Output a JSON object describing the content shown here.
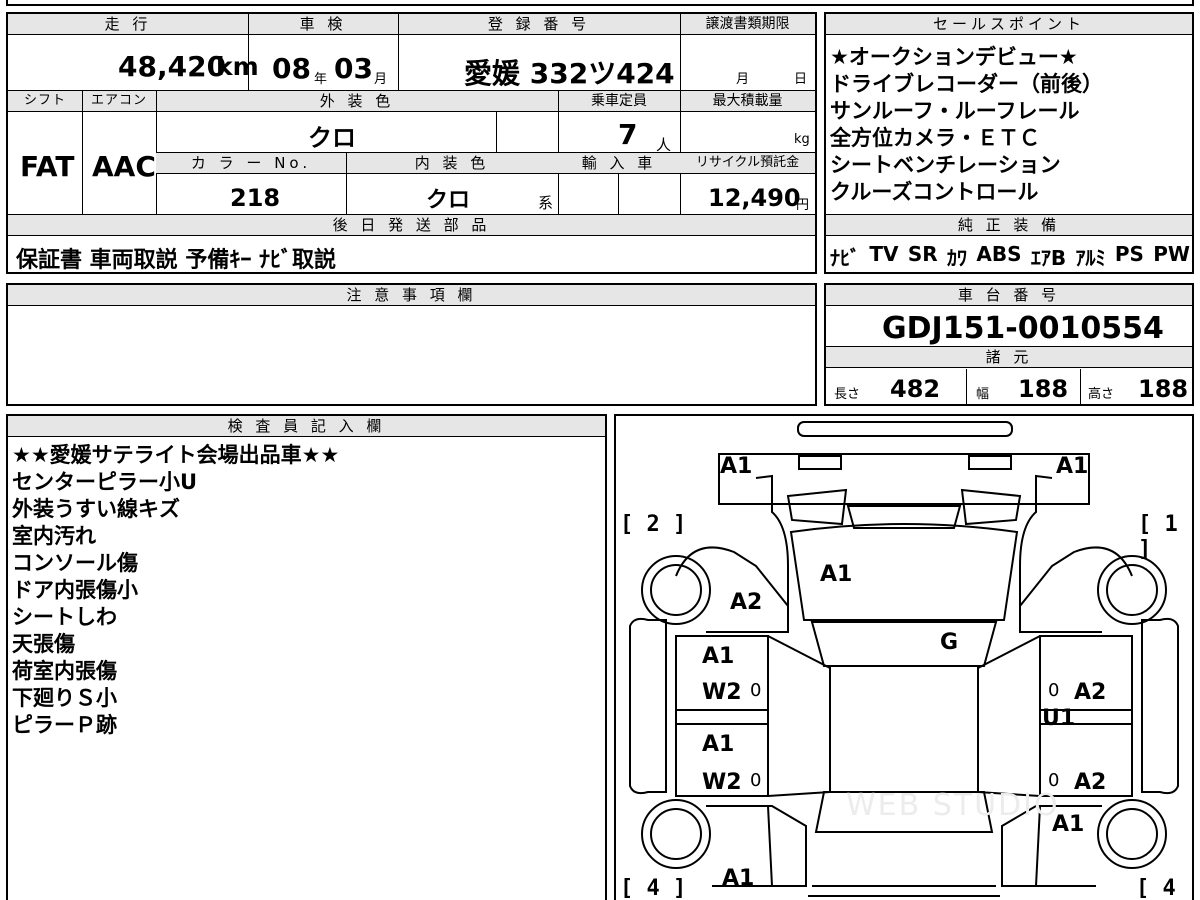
{
  "top": {
    "mileage_label": "走 行",
    "mileage_value": "48,420",
    "mileage_unit": "km",
    "shaken_label": "車 検",
    "shaken_year": "08",
    "shaken_year_unit": "年",
    "shaken_month": "03",
    "shaken_month_unit": "月",
    "reg_label": "登 録 番 号",
    "reg_value": "愛媛 332ツ424",
    "deadline_label": "譲渡書類期限",
    "deadline_month_unit": "月",
    "deadline_day_unit": "日",
    "shift_label": "シフト",
    "shift_value": "FAT",
    "ac_label": "エアコン",
    "ac_value": "AAC",
    "exterior_label": "外 装 色",
    "exterior_value": "クロ",
    "capacity_label": "乗車定員",
    "capacity_value": "7",
    "capacity_unit": "人",
    "maxload_label": "最大積載量",
    "maxload_unit": "kg",
    "colorno_label": "カ ラ ー No.",
    "colorno_value": "218",
    "interior_label": "内 装 色",
    "interior_value": "クロ",
    "interior_suffix": "系",
    "import_label": "輸 入 車",
    "recycle_label": "リサイクル預託金",
    "recycle_value": "12,490",
    "recycle_unit": "円",
    "later_label": "後 日 発 送 部 品",
    "later_value": "保証書 車両取説 予備ｷｰ ﾅﾋﾞ取説"
  },
  "sales": {
    "label": "セールスポイント",
    "items": [
      "★オークションデビュー★",
      "ドライブレコーダー（前後）",
      "サンルーフ・ルーフレール",
      "全方位カメラ・ＥＴＣ",
      "シートベンチレーション",
      "クルーズコントロール"
    ]
  },
  "equip": {
    "label": "純 正 装 備",
    "items": [
      "ﾅﾋﾞ",
      "TV",
      "SR",
      "ｶﾜ",
      "ABS",
      "ｴｱB",
      "ｱﾙﾐ",
      "PS",
      "PW"
    ]
  },
  "notes": {
    "label": "注 意 事 項 欄"
  },
  "chassis": {
    "label": "車 台 番 号",
    "value": "GDJ151-0010554"
  },
  "specs": {
    "label": "諸 元",
    "length_label": "長さ",
    "length": "482",
    "width_label": "幅",
    "width": "188",
    "height_label": "高さ",
    "height": "188"
  },
  "inspector": {
    "label": "検 査 員 記 入 欄",
    "lines": [
      "★★愛媛サテライト会場出品車★★",
      "センターピラー小U",
      "外装うすい線キズ",
      "室内汚れ",
      "コンソール傷",
      "ドア内張傷小",
      "シートしわ",
      "天張傷",
      "荷室内張傷",
      "下廻りＳ小",
      "ピラーＰ跡"
    ]
  },
  "diagram": {
    "tire_fl": "[ 2 ]",
    "tire_fr": "[ 1 ]",
    "tire_rl": "[ 4 ]",
    "tire_rr": "[ 4 ]",
    "front_bumper_left": "A1",
    "front_bumper_right": "A1",
    "hood": "A1",
    "left_fender": "A2",
    "windshield": "G",
    "left_front_door": "A1",
    "left_front_door_2": "W2",
    "left_front_door_3": "0",
    "left_rear_door": "A1",
    "left_rear_door_2": "W2",
    "left_rear_door_3": "0",
    "right_front_door": "A2",
    "right_front_door_2": "0",
    "right_pillar": "U1",
    "right_rear_door": "A2",
    "right_rear_door_2": "0",
    "right_rear_fender": "A1",
    "rear_left": "A1",
    "watermark": "WEB STUDIO"
  }
}
